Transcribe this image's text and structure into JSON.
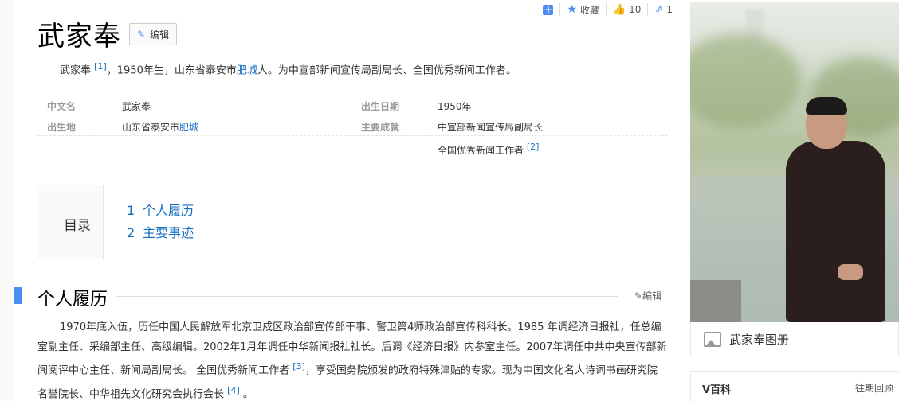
{
  "toolbar": {
    "collect_label": "收藏",
    "like_count": "10",
    "share_count": "1"
  },
  "page_title": "武家奉",
  "edit_label": "编辑",
  "summary": {
    "name": "武家奉",
    "ref1": "[1]",
    "text_a": "，1950年生，山东省泰安市",
    "link_city": "肥城",
    "text_b": "人。为中宣部新闻宣传局副局长、全国优秀新闻工作者。"
  },
  "infobox": {
    "chinese_name_label": "中文名",
    "chinese_name_value": "武家奉",
    "birth_date_label": "出生日期",
    "birth_date_value": "1950年",
    "birthplace_label": "出生地",
    "birthplace_prefix": "山东省泰安市",
    "birthplace_link": "肥城",
    "achievement_label": "主要成就",
    "achievement_1": "中宣部新闻宣传局副局长",
    "achievement_2": "全国优秀新闻工作者",
    "achievement_2_ref": "[2]"
  },
  "toc": {
    "title": "目录",
    "items": [
      {
        "num": "1",
        "label": "个人履历"
      },
      {
        "num": "2",
        "label": "主要事迹"
      }
    ]
  },
  "section": {
    "title": "个人履历",
    "edit_label": "编辑",
    "para_a": "1970年底入伍，历任中国人民解放军北京卫戍区政治部宣传部干事、警卫第4师政治部宣传科科长。1985 年调经济日报社，任总编室副主任、采编部主任、高级编辑。2002年1月年调任中华新闻报社社长。后调《经济日报》内参室主任。2007年调任中共中央宣传部新闻阅评中心主任、新闻局副局长。 全国优秀新闻工作者",
    "ref3": "[3]",
    "para_b": "，享受国务院颁发的政府特殊津贴的专家。现为中国文化名人诗词书画研究院名誉院长、中华祖先文化研究会执行会长",
    "ref4": "[4]",
    "para_c": " 。"
  },
  "sidebar": {
    "album_label": "武家奉图册",
    "vbaike_title": "V百科",
    "vbaike_link": "往期回顾"
  },
  "colors": {
    "accent": "#4b8df0",
    "link": "#136ec2"
  }
}
